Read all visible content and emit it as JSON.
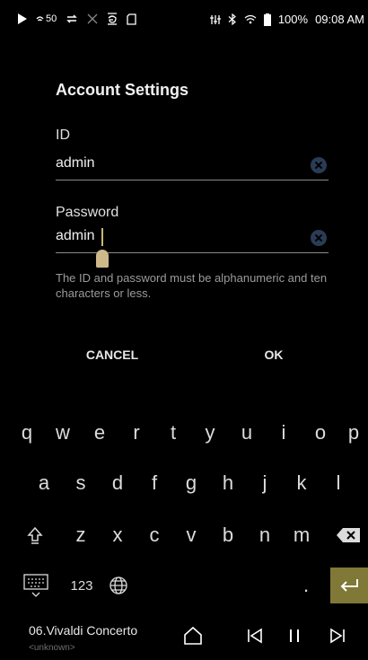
{
  "status": {
    "signal_text": "50",
    "battery": "100%",
    "time": "09:08 AM"
  },
  "dialog": {
    "title": "Account Settings",
    "id_label": "ID",
    "id_value": "admin",
    "password_label": "Password",
    "password_value": "admin",
    "hint": "The ID and password must be alphanumeric and ten characters or less.",
    "cancel": "CANCEL",
    "ok": "OK"
  },
  "keyboard": {
    "row1": [
      "q",
      "w",
      "e",
      "r",
      "t",
      "y",
      "u",
      "i",
      "o",
      "p"
    ],
    "row2": [
      "a",
      "s",
      "d",
      "f",
      "g",
      "h",
      "j",
      "k",
      "l"
    ],
    "row3": [
      "z",
      "x",
      "c",
      "v",
      "b",
      "n",
      "m"
    ],
    "num_key": "123",
    "period": "."
  },
  "player": {
    "song": "06.Vivaldi Concerto",
    "artist": "<unknown>"
  },
  "colors": {
    "accent": "#807836",
    "clear_icon": "#2a3b55"
  },
  "icons": [
    "play-icon",
    "wifi-icon",
    "repeat-icon",
    "shuffle-icon",
    "gapless-icon",
    "sd-card-icon",
    "equalizer-icon",
    "bluetooth-icon",
    "battery-icon",
    "shift-icon",
    "backspace-icon",
    "keyboard-icon",
    "globe-icon",
    "enter-icon",
    "home-icon",
    "previous-icon",
    "pause-icon",
    "next-icon"
  ]
}
